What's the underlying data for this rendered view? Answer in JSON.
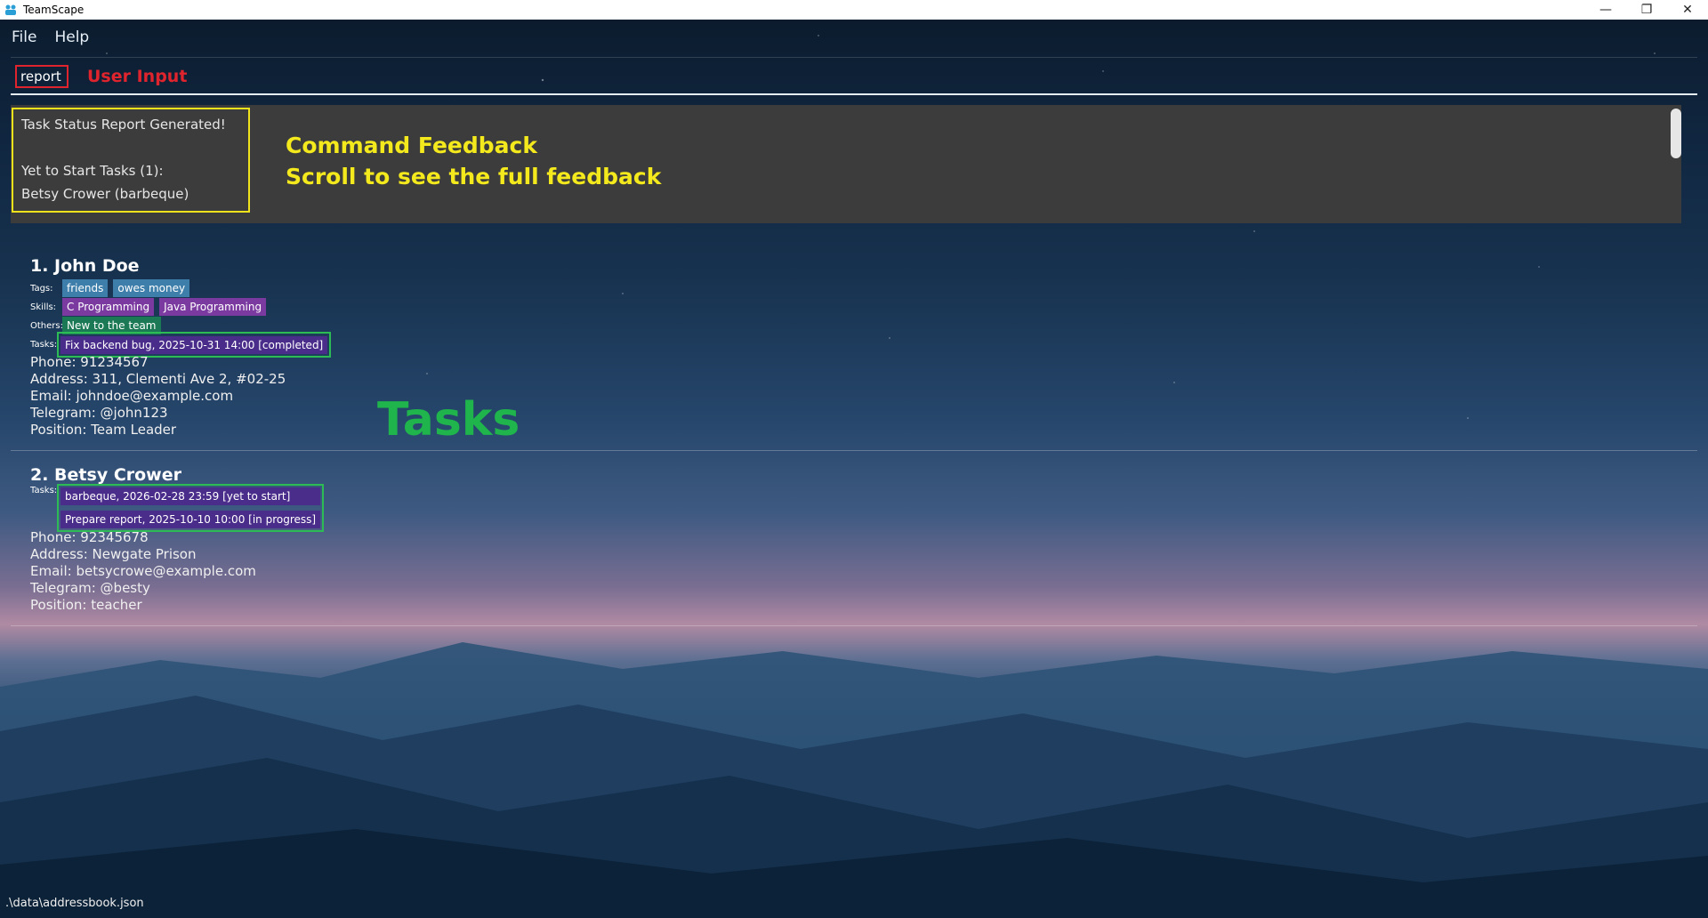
{
  "window": {
    "title": "TeamScape",
    "controls": [
      "—",
      "❐",
      "✕"
    ]
  },
  "menu": {
    "items": [
      "File",
      "Help"
    ]
  },
  "command": {
    "value": "report",
    "annotation": "User Input"
  },
  "feedback": {
    "lines": [
      "Task Status Report Generated!",
      "",
      "Yet to Start Tasks (1):",
      "Betsy Crower (barbeque)"
    ],
    "annotation_line1": "Command Feedback",
    "annotation_line2": "Scroll to see the full feedback"
  },
  "persons": [
    {
      "index_name": "1. John Doe",
      "tags_label": "Tags:",
      "tags": [
        "friends",
        "owes money"
      ],
      "skills_label": "Skills:",
      "skills": [
        "C Programming",
        "Java Programming"
      ],
      "others_label": "Others:",
      "others": [
        "New to the team"
      ],
      "tasks_label": "Tasks:",
      "tasks": [
        "Fix backend bug, 2025-10-31 14:00 [completed]"
      ],
      "phone": "Phone: 91234567",
      "address": "Address: 311, Clementi Ave 2, #02-25",
      "email": "Email: johndoe@example.com",
      "telegram": "Telegram: @john123",
      "position": "Position: Team Leader"
    },
    {
      "index_name": "2. Betsy Crower",
      "tasks_label": "Tasks:",
      "tasks": [
        "barbeque, 2026-02-28 23:59 [yet to start]",
        "Prepare report, 2025-10-10 10:00 [in progress]"
      ],
      "phone": "Phone: 92345678",
      "address": "Address: Newgate Prison",
      "email": "Email: betsycrowe@example.com",
      "telegram": "Telegram: @besty",
      "position": "Position: teacher"
    }
  ],
  "annotations": {
    "tasks": "Tasks"
  },
  "status_bar": {
    "path": ".\\data\\addressbook.json"
  },
  "colors": {
    "annot_user_input": "#e0242d",
    "annot_feedback": "#f3e91d",
    "annot_tasks": "#1fb44c",
    "tag": "#3d7eaa",
    "skill": "#7b3aa0",
    "other": "#1b7a55",
    "task": "#4a2d8a"
  }
}
